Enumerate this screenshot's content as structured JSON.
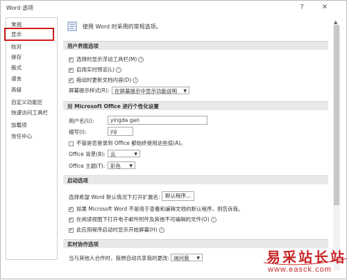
{
  "window": {
    "title": "Word 选项",
    "help_label": "?",
    "close_label": "✕"
  },
  "sidebar": {
    "items": [
      {
        "label": "常规"
      },
      {
        "label": "显示"
      },
      {
        "label": "校对"
      },
      {
        "label": "保存"
      },
      {
        "label": "版式"
      },
      {
        "label": "语言"
      },
      {
        "label": "高级"
      },
      {
        "label": "自定义功能区"
      },
      {
        "label": "快速访问工具栏"
      },
      {
        "label": "加载项"
      },
      {
        "label": "信任中心"
      }
    ],
    "highlighted": "显示",
    "highlight_color": "#d21a1a"
  },
  "intro": {
    "text": "使用 Word 时采用的常规选项。",
    "icon": "settings-list-icon"
  },
  "ui_section": {
    "heading": "用户界面选项",
    "mini_toolbar": {
      "label": "选择时显示浮动工具栏(M)",
      "checked": true
    },
    "live_preview": {
      "label": "启用实时预览(L)",
      "checked": true
    },
    "update_doc": {
      "label": "拖动时更新文档内容(D)",
      "checked": true
    },
    "tooltip_style": {
      "label": "屏幕提示样式(R):",
      "value": "在屏幕提示中显示功能说明"
    }
  },
  "personalize_section": {
    "heading": "对 Microsoft Office 进行个性化设置",
    "username": {
      "label": "用户名(U):",
      "value": "yingda gan"
    },
    "initials": {
      "label": "缩写(I):",
      "value": "yg"
    },
    "always_use": {
      "label": "不管是否登录到 Office 都始终使用这些值(A)。",
      "checked": false
    },
    "background": {
      "label": "Office 背景(B):",
      "value": "云"
    },
    "theme": {
      "label": "Office 主题(T):",
      "value": "彩色"
    }
  },
  "startup_section": {
    "heading": "启动选项",
    "extensions": {
      "label": "选择希望 Word 默认情况下打开扩展名:",
      "button": "默认程序..."
    },
    "default_check": {
      "label": "如果 Microsoft Word 不是用于查看和编辑文档的默认程序，则告诉我。",
      "checked": true
    },
    "reading_view": {
      "label": "在阅读视图下打开电子邮件附件及其他不可编辑的文件(O)",
      "checked": true
    },
    "show_start": {
      "label": "此应用程序启动时显示开始屏幕(H)",
      "checked": true
    }
  },
  "coauth_section": {
    "heading": "实时协作选项",
    "share": {
      "label": "当与其他人合作时，我想自动共享我的更改:",
      "value": "询问我"
    }
  },
  "watermark": {
    "text": "易采站长站",
    "url": "www.easck.com",
    "color": "#c72626"
  }
}
